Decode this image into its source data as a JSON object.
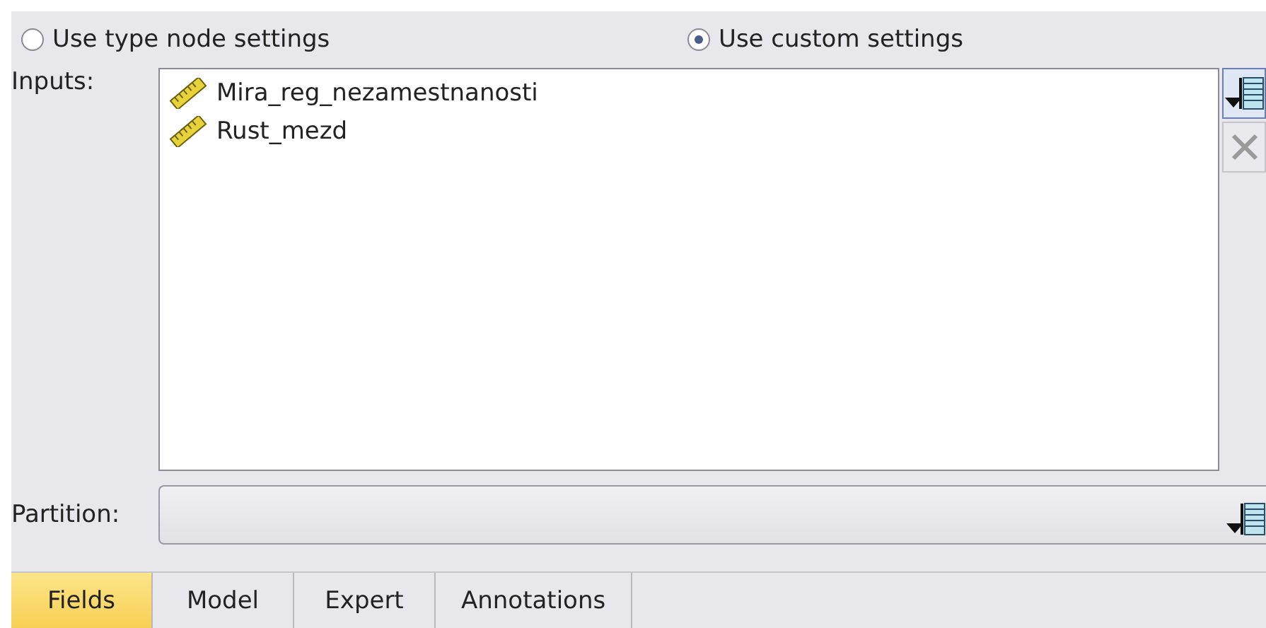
{
  "settings_mode": [
    {
      "label": "Use type node settings",
      "selected": false
    },
    {
      "label": "Use custom settings",
      "selected": true
    }
  ],
  "inputs": {
    "label": "Inputs:",
    "items": [
      "Mira_reg_nezamestnanosti",
      "Rust_mezd"
    ]
  },
  "partition": {
    "label": "Partition:"
  },
  "tabs": [
    {
      "label": "Fields",
      "selected": true
    },
    {
      "label": "Model",
      "selected": false
    },
    {
      "label": "Expert",
      "selected": false
    },
    {
      "label": "Annotations",
      "selected": false
    }
  ]
}
